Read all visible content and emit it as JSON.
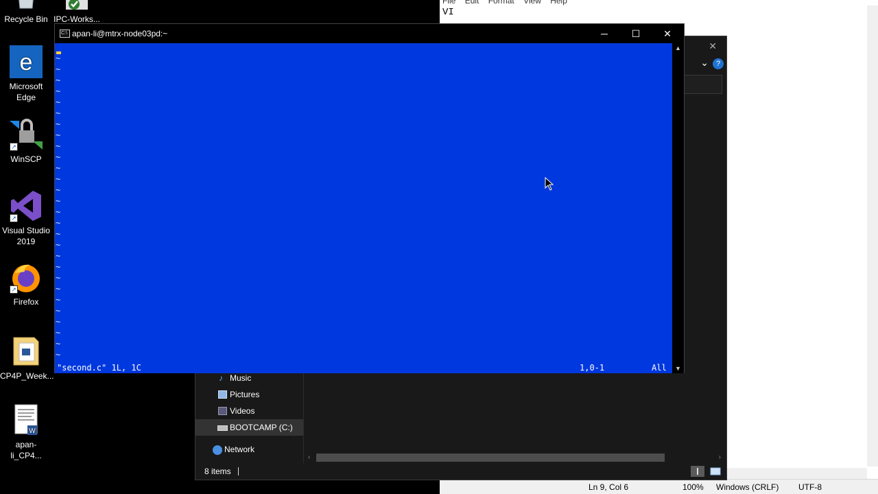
{
  "desktop": {
    "icons": [
      {
        "label": "Recycle Bin"
      },
      {
        "label": "IPC-Works..."
      },
      {
        "label": "Microsoft Edge"
      },
      {
        "label": "WinSCP"
      },
      {
        "label": "Visual Studio 2019"
      },
      {
        "label": "Firefox"
      },
      {
        "label": "CP4P_Week..."
      },
      {
        "label": "apan-li_CP4..."
      }
    ]
  },
  "notepad": {
    "menu": [
      "File",
      "Edit",
      "Format",
      "View",
      "Help"
    ],
    "content": "VI",
    "status": {
      "position": "Ln 9, Col 6",
      "zoom": "100%",
      "line_ending": "Windows (CRLF)",
      "encoding": "UTF-8"
    }
  },
  "explorer": {
    "nav_items": [
      {
        "label": "Music"
      },
      {
        "label": "Pictures"
      },
      {
        "label": "Videos"
      },
      {
        "label": "BOOTCAMP (C:)"
      },
      {
        "label": "Network"
      }
    ],
    "status_text": "8 items"
  },
  "terminal": {
    "title": "apan-li@mtrx-node03pd:~",
    "vim_file_info": "\"second.c\" 1L, 1C",
    "vim_cursor_pos": "1,0-1",
    "vim_scroll": "All",
    "tilde": "~",
    "colors": {
      "background": "#0038df",
      "cursor": "#ffd33b"
    }
  }
}
